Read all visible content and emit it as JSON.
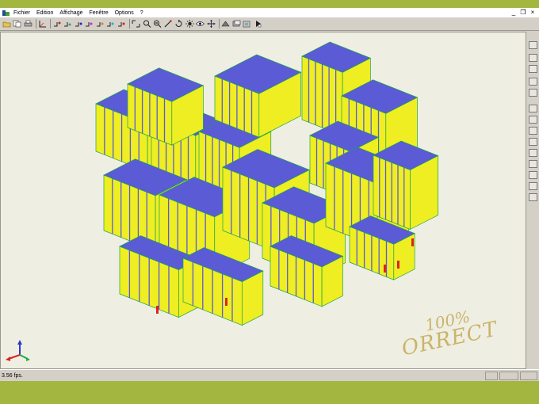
{
  "menu": {
    "items": [
      "Fichier",
      "Edition",
      "Affichage",
      "Fenêtre",
      "Options",
      "?"
    ]
  },
  "window_controls": {
    "minimize": "_",
    "restore": "❐",
    "close": "×"
  },
  "status": {
    "fps": "3.56 fps."
  },
  "watermark": {
    "line1": "100%",
    "line2": "ORRECT"
  },
  "colors": {
    "background_frame": "#a3b63f",
    "viewport": "#efeee2",
    "building_wall": "#eeee22",
    "building_roof": "#5b5bd6",
    "edges": "#1aa54a",
    "highlight": "#dd2222"
  },
  "toolbar_icons": [
    "open-icon",
    "copy-icon",
    "print-icon",
    "axis-icon",
    "node-icon",
    "node-icon-2",
    "node-icon-3",
    "node-icon-4",
    "node-icon-5",
    "node-icon-6",
    "node-icon-7",
    "zoom-window-icon",
    "zoom-icon",
    "zoom-out-icon",
    "magic-icon",
    "rotate-icon",
    "light-icon",
    "eye-icon",
    "pan-icon",
    "render-icon",
    "layers-icon",
    "copy-view-icon",
    "info-icon"
  ]
}
